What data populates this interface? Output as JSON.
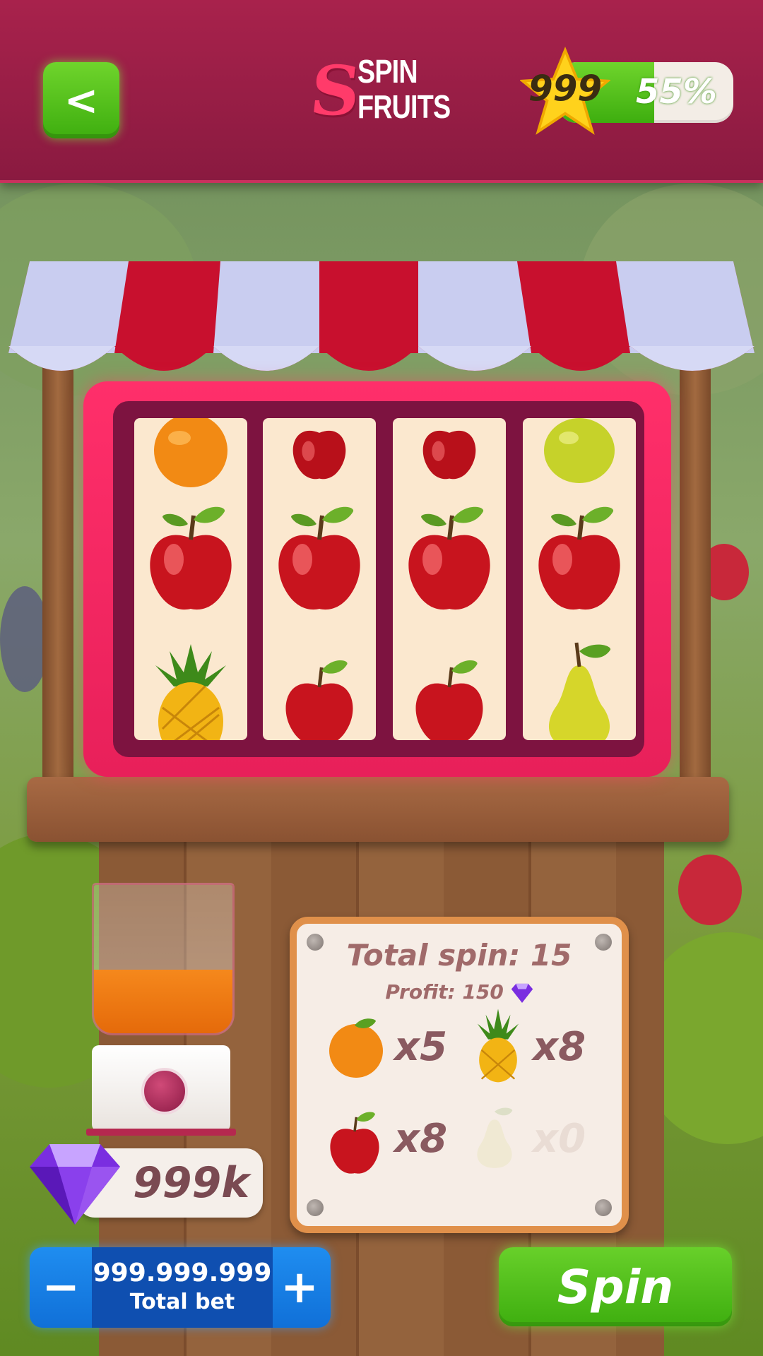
{
  "header": {
    "back_label": "<",
    "logo_initial": "S",
    "logo_line1": "SPIN",
    "logo_line2": "FRUITS",
    "level": "999",
    "progress_fraction": 0.55,
    "progress_label": "55%"
  },
  "reels": [
    [
      "orange",
      "apple",
      "pineapple"
    ],
    [
      "apple",
      "apple",
      "apple"
    ],
    [
      "apple",
      "apple",
      "apple"
    ],
    [
      "lime",
      "apple",
      "pear"
    ]
  ],
  "stats": {
    "title": "Total spin: 15",
    "profit": "Profit: 150",
    "items": [
      {
        "fruit": "orange",
        "count": "x5"
      },
      {
        "fruit": "pineapple",
        "count": "x8"
      },
      {
        "fruit": "apple",
        "count": "x8"
      },
      {
        "fruit": "pear",
        "count": "x0"
      }
    ]
  },
  "balance": {
    "gems": "999k"
  },
  "bet": {
    "minus": "−",
    "plus": "+",
    "value": "999.999.999",
    "label": "Total bet"
  },
  "spin": {
    "label": "Spin"
  },
  "colors": {
    "header": "#9a1f47",
    "accent_green": "#4fbf18",
    "reel_frame": "#ff2f6a",
    "bet_blue": "#1070d8"
  }
}
